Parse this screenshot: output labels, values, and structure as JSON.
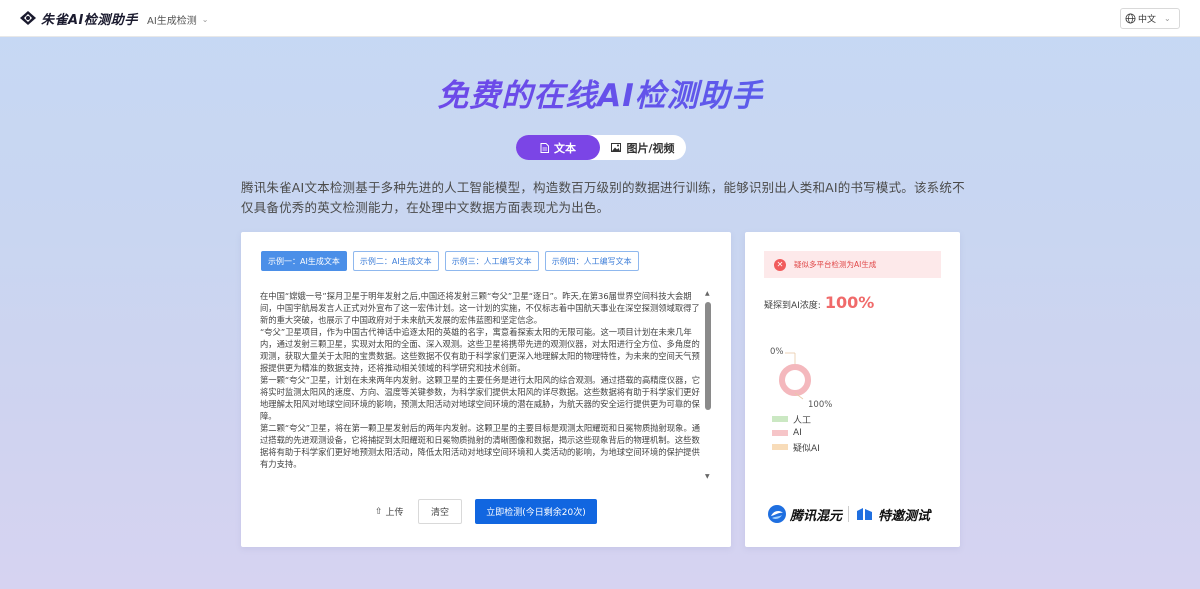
{
  "header": {
    "logo_text": "朱雀AI检测助手",
    "nav_label": "AI生成检测",
    "lang_label": "中文"
  },
  "hero": {
    "title": "免费的在线AI检测助手",
    "tabs": [
      {
        "label": "文本",
        "icon": "document-icon",
        "active": true
      },
      {
        "label": "图片/视频",
        "icon": "image-icon",
        "active": false
      }
    ],
    "intro": "腾讯朱雀AI文本检测基于多种先进的人工智能模型，构造数百万级别的数据进行训练，能够识别出人类和AI的书写模式。该系统不仅具备优秀的英文检测能力，在处理中文数据方面表现尤为出色。"
  },
  "editor": {
    "examples": [
      {
        "label": "示例一：AI生成文本",
        "active": true
      },
      {
        "label": "示例二：AI生成文本",
        "active": false
      },
      {
        "label": "示例三：人工编写文本",
        "active": false
      },
      {
        "label": "示例四：人工编写文本",
        "active": false
      }
    ],
    "paragraphs": [
      "在中国“嫦娥一号”探月卫星于明年发射之后,中国还将发射三颗“夸父”卫星“逐日”。昨天,在第36届世界空间科技大会期间，中国宇航局发言人正式对外宣布了这一宏伟计划。这一计划的实施，不仅标志着中国航天事业在深空探测领域取得了新的重大突破，也展示了中国政府对于未来航天发展的宏伟蓝图和坚定信念。",
      "“夸父”卫星项目，作为中国古代神话中追逐太阳的英雄的名字，寓意着探索太阳的无限可能。这一项目计划在未来几年内，通过发射三颗卫星，实现对太阳的全面、深入观测。这些卫星将携带先进的观测仪器，对太阳进行全方位、多角度的观测，获取大量关于太阳的宝贵数据。这些数据不仅有助于科学家们更深入地理解太阳的物理特性，为未来的空间天气预报提供更为精准的数据支持，还将推动相关领域的科学研究和技术创新。",
      "第一颗“夸父”卫星，计划在未来两年内发射。这颗卫星的主要任务是进行太阳风的综合观测。通过搭载的高精度仪器，它将实时监测太阳风的速度、方向、温度等关键参数，为科学家们提供太阳风的详尽数据。这些数据将有助于科学家们更好地理解太阳风对地球空间环境的影响，预测太阳活动对地球空间环境的潜在威胁，为航天器的安全运行提供更为可靠的保障。",
      "第二颗“夸父”卫星，将在第一颗卫星发射后的两年内发射。这颗卫星的主要目标是观测太阳耀斑和日冕物质抛射现象。通过搭载的先进观测设备，它将捕捉到太阳耀斑和日冕物质抛射的清晰图像和数据，揭示这些现象背后的物理机制。这些数据将有助于科学家们更好地预测太阳活动，降低太阳活动对地球空间环境和人类活动的影响，为地球空间环境的保护提供有力支持。"
    ],
    "upload_label": "上传",
    "clear_label": "清空",
    "detect_label": "立即检测(今日剩余20次)"
  },
  "result": {
    "alert_text": "疑似多平台检测为AI生成",
    "ai_level_label": "疑探到AI浓度:",
    "ai_level_value": "100%",
    "donut_label_zero": "0%",
    "donut_label_full": "100%",
    "legend": [
      {
        "label": "人工",
        "color": "#cbe8c3"
      },
      {
        "label": "AI",
        "color": "#f6c5c8"
      },
      {
        "label": "疑似AI",
        "color": "#f8dcb9"
      }
    ],
    "ai_fraction": 1.0,
    "brand1": "腾讯混元",
    "brand2": "特邀测试"
  }
}
